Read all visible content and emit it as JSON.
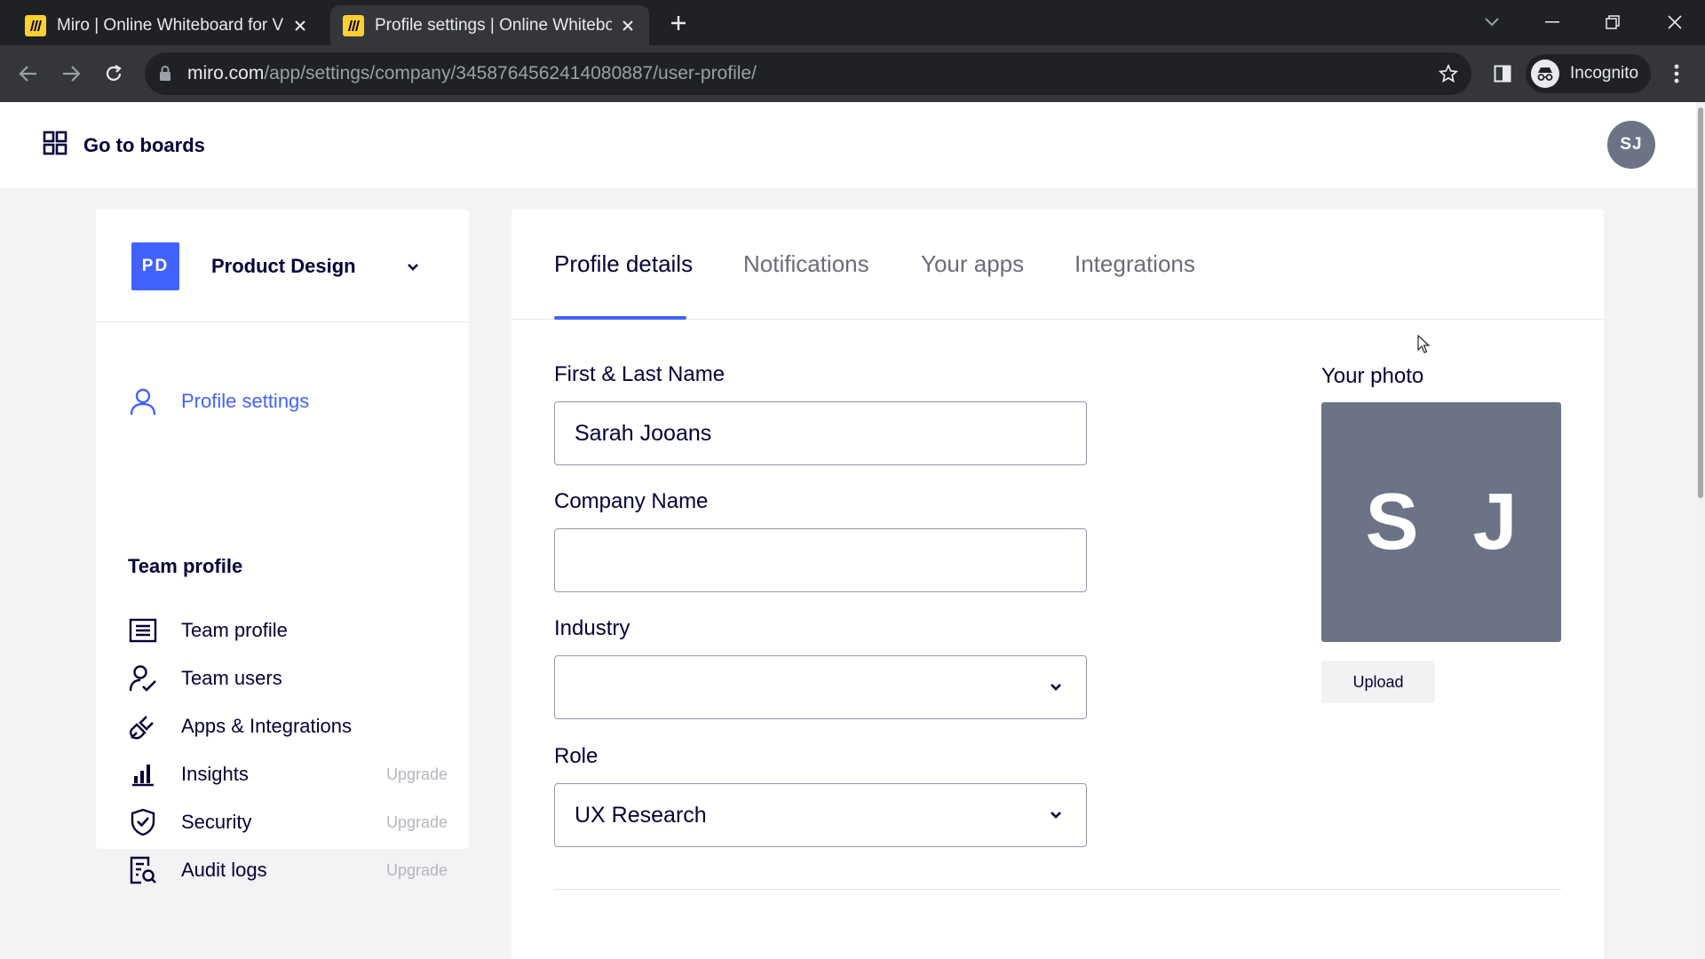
{
  "browser": {
    "tabs": [
      {
        "title": "Miro | Online Whiteboard for Visual Collaboration",
        "active": false
      },
      {
        "title": "Profile settings | Online Whiteboard for Visual Collaboration",
        "active": true
      }
    ],
    "url_host": "miro.com",
    "url_path": "/app/settings/company/3458764562414080887/user-profile/",
    "profile_label": "Incognito"
  },
  "header": {
    "go_to_boards": "Go to boards",
    "user_initials": "SJ"
  },
  "sidebar": {
    "team_initials": "PD",
    "team_name": "Product Design",
    "profile_settings": "Profile settings",
    "section_title": "Team profile",
    "items": [
      {
        "label": "Team profile",
        "icon": "list-icon",
        "badge": ""
      },
      {
        "label": "Team users",
        "icon": "user-check-icon",
        "badge": ""
      },
      {
        "label": "Apps & Integrations",
        "icon": "plug-icon",
        "badge": ""
      },
      {
        "label": "Insights",
        "icon": "bar-chart-icon",
        "badge": "Upgrade"
      },
      {
        "label": "Security",
        "icon": "shield-check-icon",
        "badge": "Upgrade"
      },
      {
        "label": "Audit logs",
        "icon": "document-search-icon",
        "badge": "Upgrade"
      }
    ]
  },
  "tabs": [
    "Profile details",
    "Notifications",
    "Your apps",
    "Integrations"
  ],
  "form": {
    "name_label": "First & Last Name",
    "name_value": "Sarah Jooans",
    "company_label": "Company Name",
    "company_value": "",
    "industry_label": "Industry",
    "industry_value": "",
    "role_label": "Role",
    "role_value": "UX Research"
  },
  "photo": {
    "label": "Your photo",
    "initials": "S J",
    "upload_label": "Upload"
  },
  "colors": {
    "accent": "#4262ff",
    "avatar_bg": "#6b7385",
    "text_primary": "#050038",
    "chrome_dark": "#202124"
  }
}
